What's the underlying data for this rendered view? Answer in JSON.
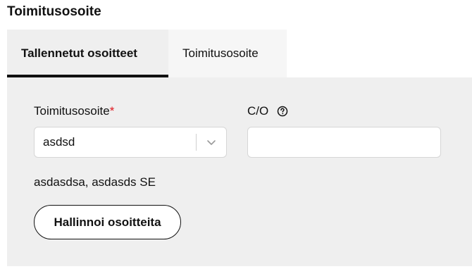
{
  "section": {
    "title": "Toimitusosoite"
  },
  "tabs": [
    {
      "label": "Tallennetut osoitteet",
      "active": true
    },
    {
      "label": "Toimitusosoite",
      "active": false
    }
  ],
  "form": {
    "address_label": "Toimitusosoite",
    "required_marker": "*",
    "address_select_value": "asdsd",
    "co_label": "C/O",
    "co_value": "",
    "selected_address_text": "asdasdsa, asdasds SE",
    "manage_button_label": "Hallinnoi osoitteita"
  },
  "icons": {
    "select_chevron": "chevron-down-icon",
    "co_help": "help-circle-icon"
  },
  "colors": {
    "required": "#e0161e",
    "panel_bg": "#efefef",
    "active_tab_underline": "#111111"
  }
}
